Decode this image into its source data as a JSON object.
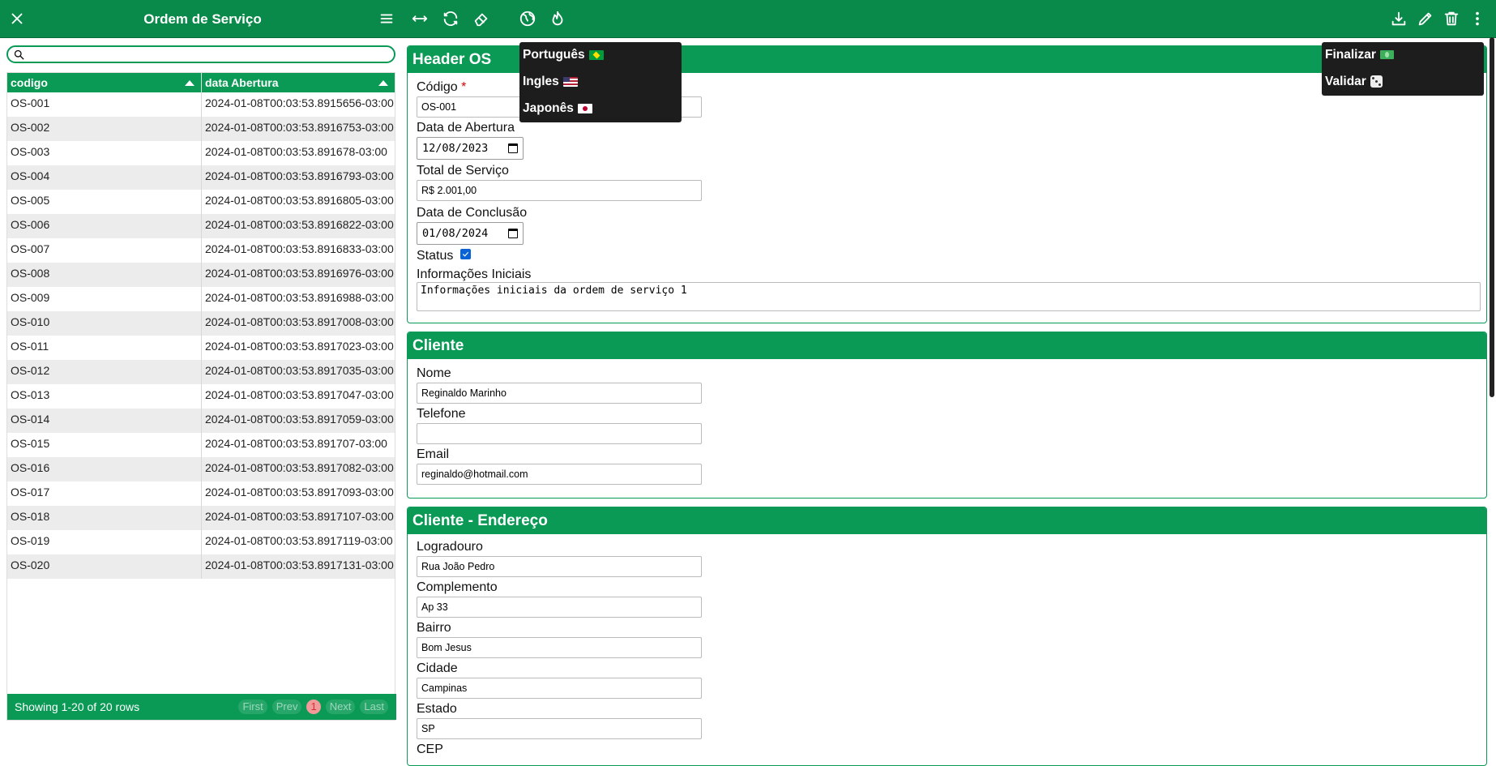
{
  "app": {
    "title": "Ordem de Serviço"
  },
  "search": {
    "placeholder": "",
    "value": ""
  },
  "table": {
    "columns": [
      "codigo",
      "data Abertura"
    ],
    "rows": [
      [
        "OS-001",
        "2024-01-08T00:03:53.8915656-03:00"
      ],
      [
        "OS-002",
        "2024-01-08T00:03:53.8916753-03:00"
      ],
      [
        "OS-003",
        "2024-01-08T00:03:53.891678-03:00"
      ],
      [
        "OS-004",
        "2024-01-08T00:03:53.8916793-03:00"
      ],
      [
        "OS-005",
        "2024-01-08T00:03:53.8916805-03:00"
      ],
      [
        "OS-006",
        "2024-01-08T00:03:53.8916822-03:00"
      ],
      [
        "OS-007",
        "2024-01-08T00:03:53.8916833-03:00"
      ],
      [
        "OS-008",
        "2024-01-08T00:03:53.8916976-03:00"
      ],
      [
        "OS-009",
        "2024-01-08T00:03:53.8916988-03:00"
      ],
      [
        "OS-010",
        "2024-01-08T00:03:53.8917008-03:00"
      ],
      [
        "OS-011",
        "2024-01-08T00:03:53.8917023-03:00"
      ],
      [
        "OS-012",
        "2024-01-08T00:03:53.8917035-03:00"
      ],
      [
        "OS-013",
        "2024-01-08T00:03:53.8917047-03:00"
      ],
      [
        "OS-014",
        "2024-01-08T00:03:53.8917059-03:00"
      ],
      [
        "OS-015",
        "2024-01-08T00:03:53.891707-03:00"
      ],
      [
        "OS-016",
        "2024-01-08T00:03:53.8917082-03:00"
      ],
      [
        "OS-017",
        "2024-01-08T00:03:53.8917093-03:00"
      ],
      [
        "OS-018",
        "2024-01-08T00:03:53.8917107-03:00"
      ],
      [
        "OS-019",
        "2024-01-08T00:03:53.8917119-03:00"
      ],
      [
        "OS-020",
        "2024-01-08T00:03:53.8917131-03:00"
      ]
    ],
    "footer": {
      "info": "Showing 1-20 of 20 rows",
      "first": "First",
      "prev": "Prev",
      "page": "1",
      "next": "Next",
      "last": "Last"
    }
  },
  "header_os": {
    "title": "Header OS",
    "codigo_label": "Código",
    "required_mark": "*",
    "codigo_value": "OS-001",
    "data_abertura_label": "Data de Abertura",
    "data_abertura_value": "12/08/2023",
    "total_label": "Total de Serviço",
    "total_value": "R$ 2.001,00",
    "data_conclusao_label": "Data de Conclusão",
    "data_conclusao_value": "01/08/2024",
    "status_label": "Status",
    "status_checked": true,
    "info_label": "Informações Iniciais",
    "info_value": "Informações iniciais da ordem de serviço 1"
  },
  "cliente": {
    "title": "Cliente",
    "nome_label": "Nome",
    "nome_value": "Reginaldo Marinho",
    "telefone_label": "Telefone",
    "telefone_value": "",
    "email_label": "Email",
    "email_value": "reginaldo@hotmail.com"
  },
  "endereco": {
    "title": "Cliente - Endereço",
    "logradouro_label": "Logradouro",
    "logradouro_value": "Rua João Pedro",
    "complemento_label": "Complemento",
    "complemento_value": "Ap 33",
    "bairro_label": "Bairro",
    "bairro_value": "Bom Jesus",
    "cidade_label": "Cidade",
    "cidade_value": "Campinas",
    "estado_label": "Estado",
    "estado_value": "SP",
    "cep_label": "CEP"
  },
  "language_menu": {
    "items": [
      {
        "label": "Português",
        "icon": "brazil-flag-icon"
      },
      {
        "label": "Ingles",
        "icon": "us-flag-icon"
      },
      {
        "label": "Japonês",
        "icon": "japan-flag-icon"
      }
    ]
  },
  "actions_menu": {
    "items": [
      {
        "label": "Finalizar",
        "icon": "money-icon"
      },
      {
        "label": "Validar",
        "icon": "die-icon"
      }
    ]
  },
  "colors": {
    "primary": "#0a9a56",
    "topbar": "#0a8a4a",
    "menu_bg": "#1d1d1d"
  }
}
